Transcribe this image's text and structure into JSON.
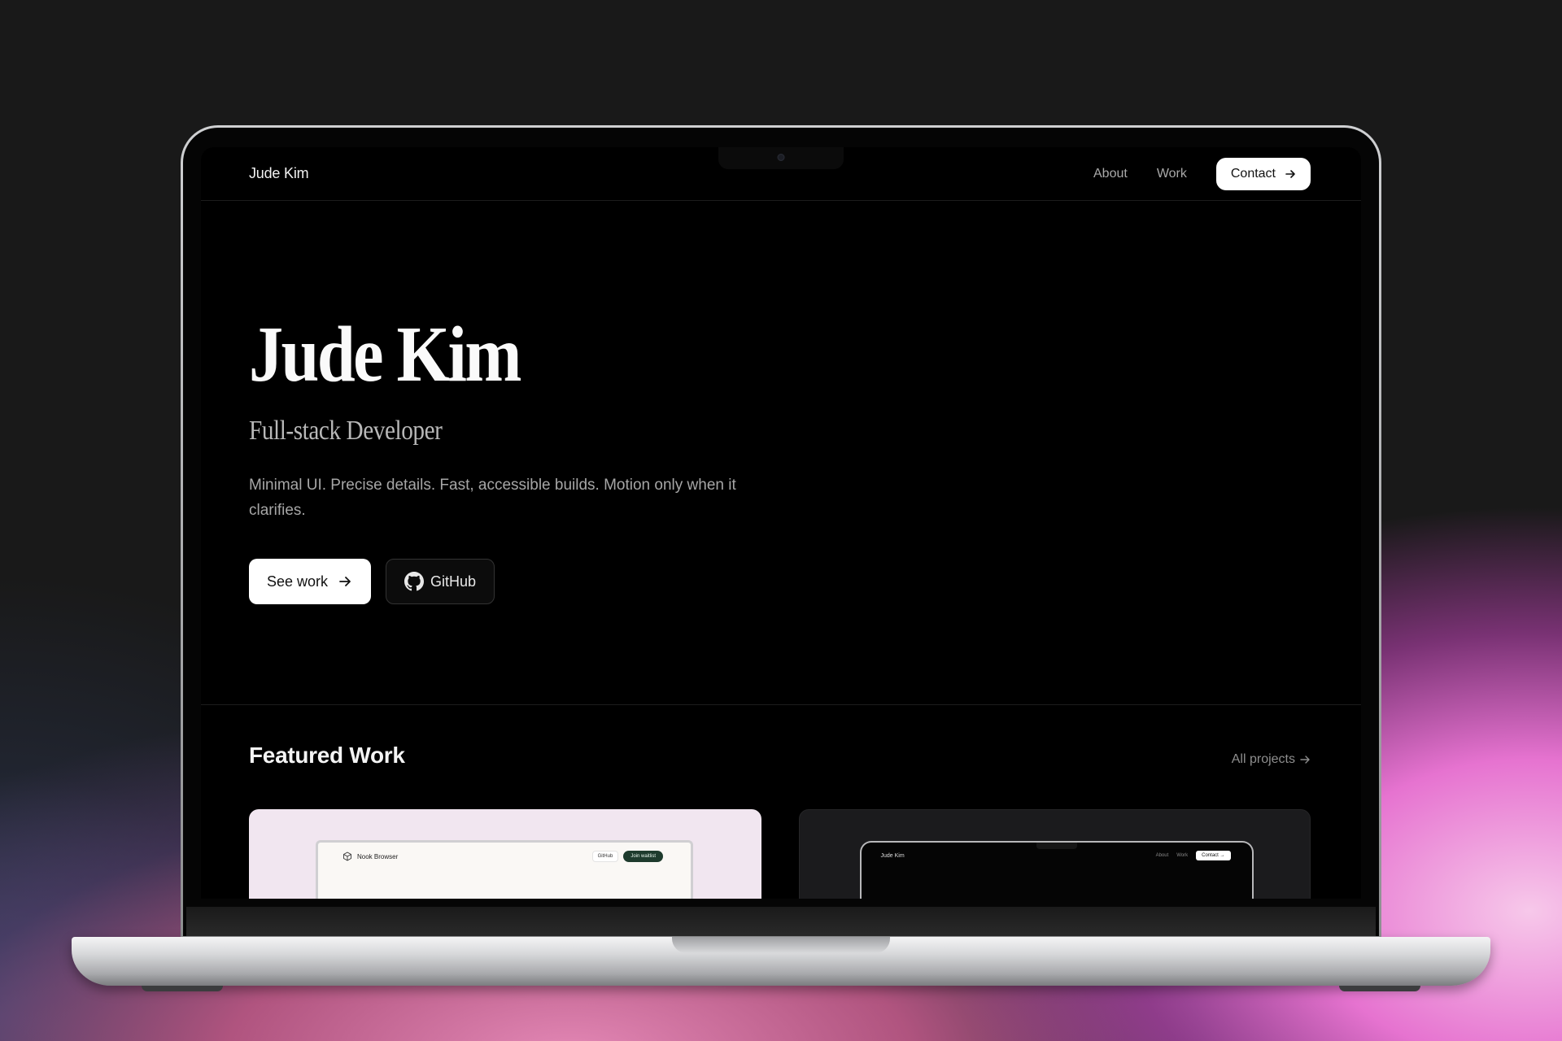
{
  "nav": {
    "brand": "Jude Kim",
    "links": [
      "About",
      "Work"
    ],
    "contact_label": "Contact"
  },
  "hero": {
    "name": "Jude Kim",
    "role": "Full-stack Developer",
    "description": "Minimal UI. Precise details. Fast, accessible builds. Motion only when it clarifies.",
    "primary_label": "See work",
    "secondary_label": "GitHub"
  },
  "featured": {
    "title": "Featured Work",
    "all_projects_label": "All projects",
    "cards": [
      {
        "preview_brand": "Nook Browser",
        "preview_github": "GitHub",
        "preview_cta": "Join waitlist"
      },
      {
        "preview_brand": "Jude Kim",
        "preview_links": [
          "About",
          "Work"
        ],
        "preview_contact": "Contact"
      }
    ]
  },
  "colors": {
    "background": "#191919",
    "screen": "#000000",
    "accent_pink": "#e673d0",
    "card_1_bg": "#f1e6f0",
    "card_2_bg": "#1b1b1d",
    "waitlist_green": "#1e3b2d"
  },
  "icons": [
    "arrow-right-icon",
    "github-icon",
    "cube-icon",
    "camera-icon"
  ]
}
